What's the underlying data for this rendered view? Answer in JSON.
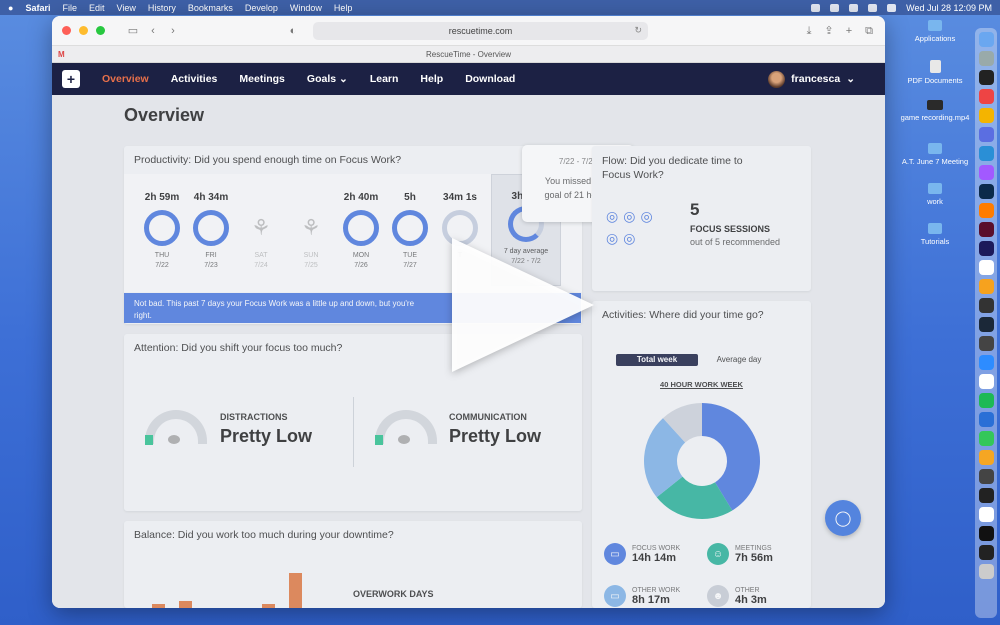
{
  "menubar": {
    "apple": "",
    "app": "Safari",
    "menus": [
      "File",
      "Edit",
      "View",
      "History",
      "Bookmarks",
      "Develop",
      "Window",
      "Help"
    ],
    "clock": "Wed Jul 28  12:09 PM"
  },
  "desktop": {
    "items": [
      {
        "label": "Applications",
        "icon": "folder-icon"
      },
      {
        "label": "PDF Documents",
        "icon": "document-icon"
      },
      {
        "label": "game recording.mp4",
        "icon": "video-file-icon"
      },
      {
        "label": "A.T. June 7 Meeting",
        "icon": "folder-icon"
      },
      {
        "label": "work",
        "icon": "folder-icon"
      },
      {
        "label": "Tutorials",
        "icon": "folder-icon"
      }
    ]
  },
  "browser": {
    "url": "rescuetime.com",
    "tab_title": "RescueTime - Overview",
    "gmail_tab": "M"
  },
  "nav": {
    "items": [
      "Overview",
      "Activities",
      "Meetings",
      "Goals",
      "Learn",
      "Help",
      "Download"
    ],
    "goals_caret": "⌄",
    "user": "francesca",
    "user_caret": "⌄"
  },
  "page": {
    "title": "Overview"
  },
  "productivity": {
    "title": "Productivity: Did you spend enough time on Focus Work?",
    "days": [
      {
        "duration": "2h 59m",
        "day": "THU",
        "date": "7/22",
        "state": "full"
      },
      {
        "duration": "4h 34m",
        "day": "FRI",
        "date": "7/23",
        "state": "full"
      },
      {
        "duration": "",
        "day": "SAT",
        "date": "7/24",
        "state": "plant"
      },
      {
        "duration": "",
        "day": "SUN",
        "date": "7/25",
        "state": "plant"
      },
      {
        "duration": "2h 40m",
        "day": "MON",
        "date": "7/26",
        "state": "full"
      },
      {
        "duration": "5h",
        "day": "TUE",
        "date": "7/27",
        "state": "full"
      },
      {
        "duration": "34m 1s",
        "day": "T",
        "date": "",
        "state": "partial"
      }
    ],
    "average": {
      "duration": "3h 9m",
      "label": "7 day average",
      "range": "7/22 - 7/2"
    },
    "banner": "Not bad. This past 7 days your Focus Work was a little up and down, but you're",
    "banner_line2": "right.",
    "tooltip": {
      "date": "7/22 - 7/28",
      "line1": "You missed your",
      "line2": "goal of 21 hours."
    }
  },
  "flow": {
    "title_line1": "Flow: Did you dedicate time to",
    "title_line2": "Focus Work?",
    "count": "5",
    "label": "FOCUS SESSIONS",
    "sub": "out of 5 recommended"
  },
  "attention": {
    "title": "Attention: Did you shift your focus too much?",
    "distractions_label": "DISTRACTIONS",
    "distractions_value": "Pretty Low",
    "communication_label": "COMMUNICATION",
    "communication_value": "Pretty Low"
  },
  "activities": {
    "title": "Activities: Where did your time go?",
    "tabs": [
      "Total week",
      "Average day"
    ],
    "subtitle": "40 HOUR WORK WEEK",
    "stats": [
      {
        "label": "FOCUS WORK",
        "value": "14h 14m",
        "color": "#4a78e0"
      },
      {
        "label": "MEETINGS",
        "value": "7h 56m",
        "color": "#2bb39a"
      },
      {
        "label": "OTHER WORK",
        "value": "8h 17m",
        "color": "#7fb3e8"
      },
      {
        "label": "OTHER",
        "value": "4h 3m",
        "color": "#c9cdd6"
      }
    ]
  },
  "balance": {
    "title": "Balance: Did you work too much during your downtime?",
    "overwork_label": "OVERWORK DAYS"
  },
  "chart_data": {
    "type": "pie",
    "categories": [
      "Focus Work",
      "Meetings",
      "Other Work",
      "Other"
    ],
    "values": [
      14.23,
      7.93,
      8.28,
      4.05
    ],
    "colors": [
      "#4a78e0",
      "#2bb39a",
      "#7fb3e8",
      "#cfd4dc"
    ]
  }
}
